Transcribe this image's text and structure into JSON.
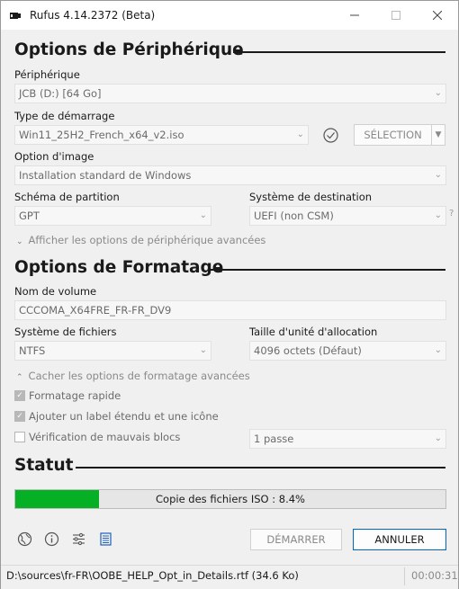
{
  "window": {
    "title": "Rufus 4.14.2372 (Beta)"
  },
  "device_section": {
    "heading": "Options de Périphérique",
    "device_label": "Périphérique",
    "device_value": "JCB (D:) [64 Go]",
    "boot_label": "Type de démarrage",
    "boot_value": "Win11_25H2_French_x64_v2.iso",
    "select_button": "SÉLECTION",
    "image_option_label": "Option d'image",
    "image_option_value": "Installation standard de Windows",
    "partition_label": "Schéma de partition",
    "partition_value": "GPT",
    "target_label": "Système de destination",
    "target_value": "UEFI (non CSM)",
    "help_mark": "?",
    "advanced_toggle": "Afficher les options de périphérique avancées"
  },
  "format_section": {
    "heading": "Options de Formatage",
    "volume_label": "Nom de volume",
    "volume_value": "CCCOMA_X64FRE_FR-FR_DV9",
    "fs_label": "Système de fichiers",
    "fs_value": "NTFS",
    "cluster_label": "Taille d'unité d'allocation",
    "cluster_value": "4096 octets (Défaut)",
    "advanced_toggle": "Cacher les options de formatage avancées",
    "quick_format": "Formatage rapide",
    "quick_format_checked": true,
    "extended_label": "Ajouter un label étendu et une icône",
    "extended_label_checked": true,
    "bad_blocks": "Vérification de mauvais blocs",
    "bad_blocks_checked": false,
    "passes_value": "1 passe"
  },
  "status_section": {
    "heading": "Statut",
    "progress_text": "Copie des fichiers ISO : 8.4%",
    "progress_fraction": 0.194,
    "progress_color": "#06b025"
  },
  "toolbar": {
    "icons": [
      "globe-icon",
      "info-icon",
      "settings-icon",
      "log-icon"
    ],
    "start_button": "DÉMARRER",
    "cancel_button": "ANNULER"
  },
  "statusbar": {
    "text": "D:\\sources\\fr-FR\\OOBE_HELP_Opt_in_Details.rtf (34.6 Ko)",
    "time": "00:00:31"
  }
}
